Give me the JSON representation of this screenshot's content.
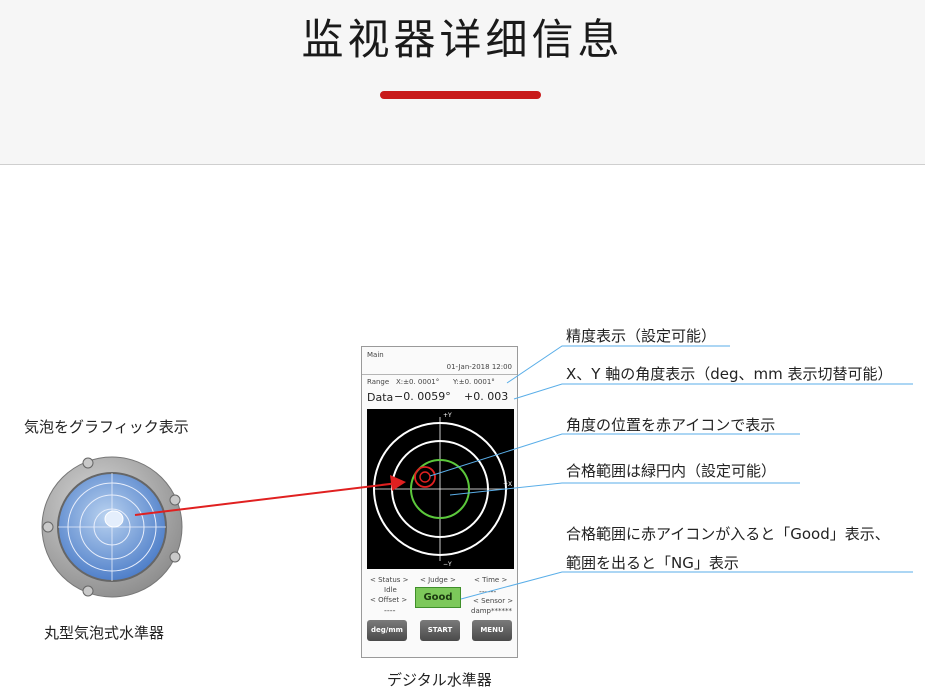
{
  "header": {
    "title": "监视器详细信息"
  },
  "left": {
    "graphic_caption": "気泡をグラフィック表示",
    "level_caption": "丸型気泡式水準器"
  },
  "device": {
    "caption": "デジタル水準器",
    "main_label": "Main",
    "date": "01-Jan-2018 12:00",
    "range_label": "Range",
    "range_x": "X:±0. 0001°",
    "range_y": "Y:±0. 0001°",
    "data_label": "Data",
    "data_x": "−0. 0059°",
    "data_y": "+0. 003",
    "axis_plus_y": "+Y",
    "axis_minus_y": "−Y",
    "axis_plus_x": "+X",
    "status_caption": "< Status >",
    "status_value": "Idle",
    "offset_caption": "< Offset >",
    "offset_value": "----",
    "judge_caption": "< Judge >",
    "judge_value": "Good",
    "time_caption": "< Time >",
    "time_value": "------",
    "sensor_caption": "< Sensor >",
    "sensor_value": "damp******",
    "buttons": {
      "deg": "deg/mm",
      "start": "START",
      "menu": "MENU"
    }
  },
  "annotations": {
    "precision": "精度表示（設定可能）",
    "axes": "X、Y 軸の角度表示（deg、mm 表示切替可能）",
    "angle_position": "角度の位置を赤アイコンで表示",
    "pass_range": "合格範囲は緑円内（設定可能）",
    "good_line1": "合格範囲に赤アイコンが入ると「Good」表示、",
    "good_line2": "範囲を出ると「NG」表示"
  },
  "colors": {
    "accent_red": "#c81a1a",
    "annotation_line": "#5aaee8",
    "pass_circle": "#5cc83c",
    "judge_good": "#7cc85a"
  }
}
